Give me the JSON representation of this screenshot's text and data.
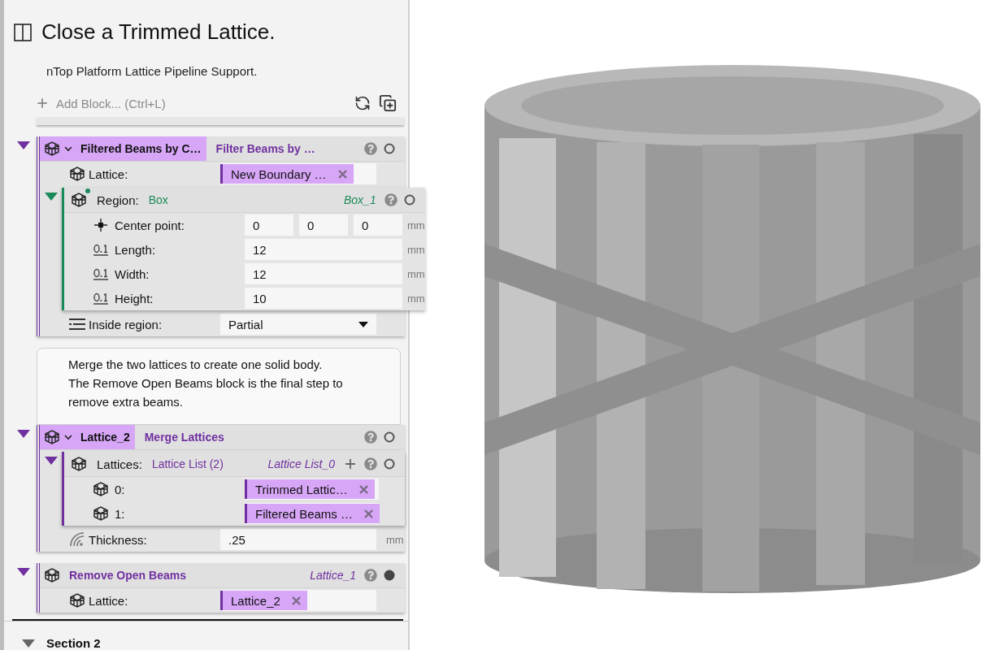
{
  "panel": {
    "title": "Close a Trimmed Lattice.",
    "description": "nTop Platform Lattice Pipeline Support.",
    "add_block": "Add Block... (Ctrl+L)"
  },
  "items": [
    {
      "kind": "block",
      "expanded": true,
      "complete": false,
      "name": "Filtered Beams by C…",
      "type": "Filter Beams by …",
      "rows": [
        {
          "kind": "lattice_input",
          "label": "Lattice:",
          "chip": "New Boundary …"
        },
        {
          "kind": "nested",
          "expanded": true,
          "complete": false,
          "modified": true,
          "addable": false,
          "color": "#1a8a5a",
          "label": "Region:",
          "type": "Box",
          "variable": "Box_1",
          "rows": [
            {
              "kind": "point_input",
              "label": "Center point:",
              "values": [
                "0",
                "0",
                "0"
              ],
              "unit": "mm"
            },
            {
              "kind": "scalar_input",
              "label": "Length:",
              "value": "12",
              "unit": "mm"
            },
            {
              "kind": "scalar_input",
              "label": "Width:",
              "value": "12",
              "unit": "mm"
            },
            {
              "kind": "scalar_input",
              "label": "Height:",
              "value": "10",
              "unit": "mm"
            }
          ]
        },
        {
          "kind": "enum_input",
          "label": "Inside region:",
          "value": "Partial"
        }
      ]
    },
    {
      "kind": "note",
      "text": "Merge the two lattices to create one solid body.\nThe Remove Open Beams block is the final step to\nremove extra beams."
    },
    {
      "kind": "block",
      "expanded": true,
      "complete": false,
      "name": "Lattice_2",
      "type": "Merge Lattices",
      "rows": [
        {
          "kind": "nested",
          "expanded": true,
          "complete": false,
          "modified": false,
          "addable": true,
          "color": "#7030a0",
          "label": "Lattices:",
          "type": "Lattice List (2)",
          "variable": "Lattice List_0",
          "rows": [
            {
              "kind": "lattice_input",
              "label": "0:",
              "chip": "Trimmed Lattic…"
            },
            {
              "kind": "lattice_input",
              "label": "1:",
              "chip": "Filtered Beams …"
            }
          ]
        },
        {
          "kind": "distance_input",
          "label": "Thickness:",
          "value": ".25",
          "unit": "mm"
        }
      ]
    },
    {
      "kind": "block",
      "expanded": true,
      "complete": true,
      "type": "Remove Open Beams",
      "variable": "Lattice_1",
      "rows": [
        {
          "kind": "lattice_input",
          "label": "Lattice:",
          "chip": "Lattice_2"
        }
      ]
    }
  ],
  "section": {
    "label": "Section 2",
    "expanded": true
  }
}
